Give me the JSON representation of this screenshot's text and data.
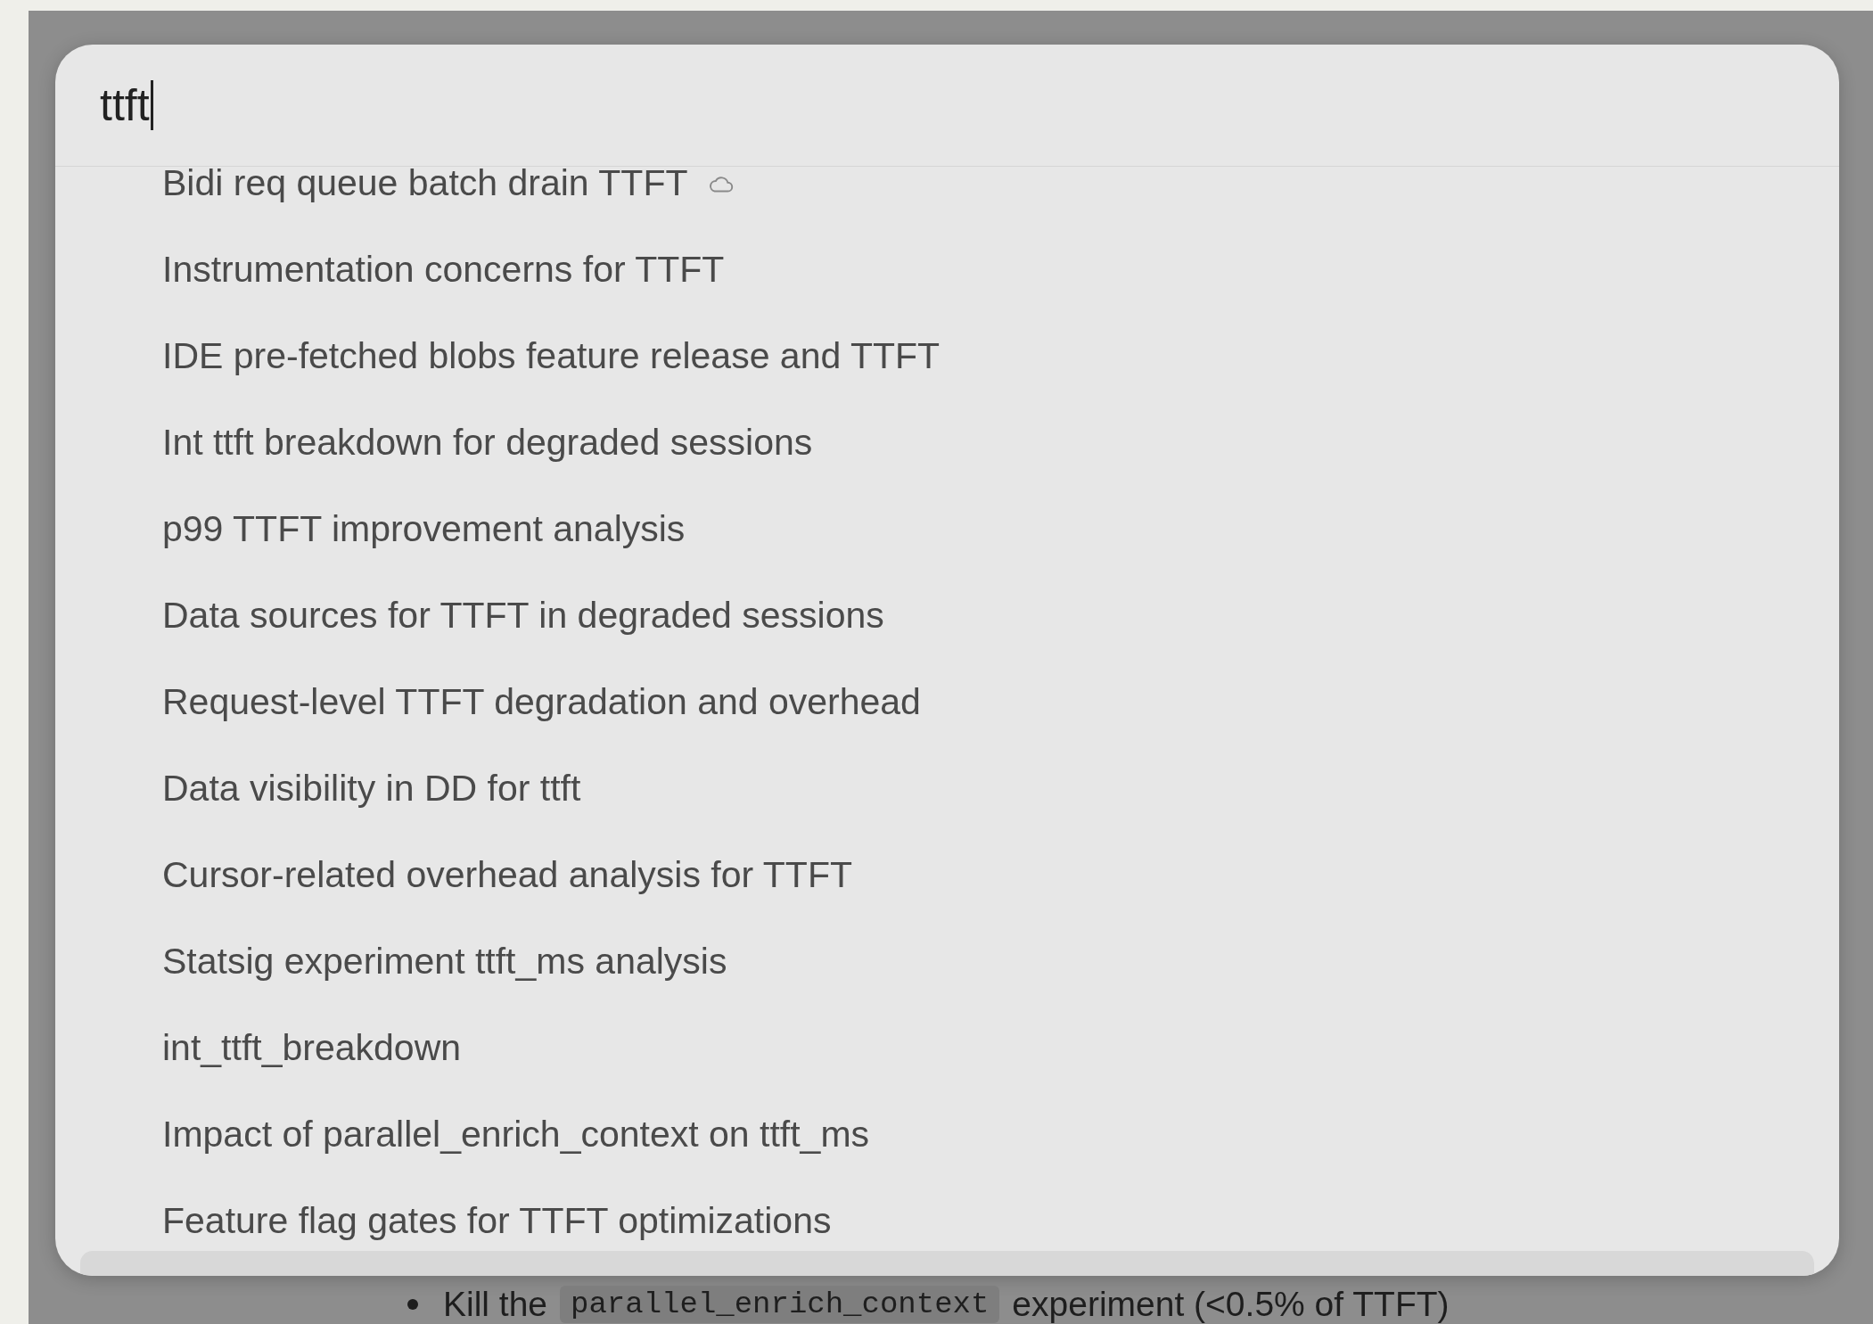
{
  "search": {
    "value": "ttft"
  },
  "results": [
    {
      "label": "Bidi req queue batch drain TTFT",
      "cloud": true
    },
    {
      "label": "Instrumentation concerns for TTFT",
      "cloud": false
    },
    {
      "label": "IDE pre-fetched blobs feature release and TTFT",
      "cloud": false
    },
    {
      "label": "Int ttft breakdown for degraded sessions",
      "cloud": false
    },
    {
      "label": "p99 TTFT improvement analysis",
      "cloud": false
    },
    {
      "label": "Data sources for TTFT in degraded sessions",
      "cloud": false
    },
    {
      "label": "Request-level TTFT degradation and overhead",
      "cloud": false
    },
    {
      "label": "Data visibility in DD for ttft",
      "cloud": false
    },
    {
      "label": "Cursor-related overhead analysis for TTFT",
      "cloud": false
    },
    {
      "label": "Statsig experiment ttft_ms analysis",
      "cloud": false
    },
    {
      "label": "int_ttft_breakdown",
      "cloud": false
    },
    {
      "label": "Impact of parallel_enrich_context on ttft_ms",
      "cloud": false
    },
    {
      "label": "Feature flag gates for TTFT optimizations",
      "cloud": false
    }
  ],
  "background": {
    "bullet": {
      "before": "Kill the",
      "code": "parallel_enrich_context",
      "after": "experiment (<0.5% of TTFT)"
    }
  }
}
